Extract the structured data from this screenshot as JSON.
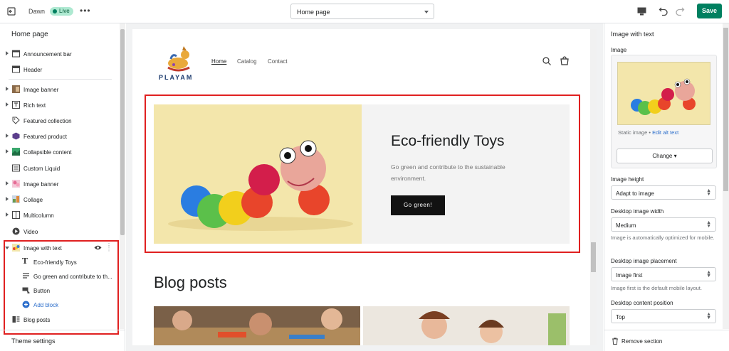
{
  "topbar": {
    "theme_name": "Dawn",
    "live_badge": "Live",
    "more_icon": "ellipsis-icon",
    "page_select": "Home page",
    "save_label": "Save"
  },
  "sidebar": {
    "title": "Home page",
    "items": [
      {
        "label": "Announcement bar",
        "icon": "announcement-icon"
      },
      {
        "label": "Header",
        "icon": "header-icon"
      },
      {
        "label": "Image banner",
        "icon": "image-thumbnail"
      },
      {
        "label": "Rich text",
        "icon": "rich-text-icon"
      },
      {
        "label": "Featured collection",
        "icon": "tag-icon"
      },
      {
        "label": "Featured product",
        "icon": "product-thumbnail"
      },
      {
        "label": "Collapsible content",
        "icon": "collapsible-thumbnail"
      },
      {
        "label": "Custom Liquid",
        "icon": "liquid-icon"
      },
      {
        "label": "Image banner",
        "icon": "image-thumbnail"
      },
      {
        "label": "Collage",
        "icon": "collage-thumbnail"
      },
      {
        "label": "Multicolumn",
        "icon": "columns-icon"
      },
      {
        "label": "Video",
        "icon": "play-icon"
      },
      {
        "label": "Image with text",
        "icon": "image-thumbnail"
      },
      {
        "label": "Eco-friendly Toys",
        "icon": "text-icon"
      },
      {
        "label": "Go green and contribute to th...",
        "icon": "paragraph-icon"
      },
      {
        "label": "Button",
        "icon": "button-icon"
      },
      {
        "label": "Add block",
        "icon": "plus-circle-icon"
      },
      {
        "label": "Blog posts",
        "icon": "blog-icon"
      }
    ],
    "theme_settings": "Theme settings"
  },
  "preview": {
    "logo_text": "PLAYAM",
    "nav": [
      "Home",
      "Catalog",
      "Contact"
    ],
    "hero_title": "Eco-friendly Toys",
    "hero_body": "Go green and contribute to the sustainable environment.",
    "hero_button": "Go green!",
    "blog_heading": "Blog posts"
  },
  "rpanel": {
    "title": "Image with text",
    "image_label": "Image",
    "static_image": "Static image",
    "edit_alt": "Edit alt text",
    "change_label": "Change",
    "image_height_label": "Image height",
    "image_height_value": "Adapt to image",
    "desktop_width_label": "Desktop image width",
    "desktop_width_value": "Medium",
    "desktop_width_help": "Image is automatically optimized for mobile.",
    "placement_label": "Desktop image placement",
    "placement_value": "Image first",
    "placement_help": "Image first is the default mobile layout.",
    "content_position_label": "Desktop content position",
    "content_position_value": "Top",
    "remove_section": "Remove section"
  },
  "colors": {
    "save_green": "#008060",
    "highlight_red": "#e02020",
    "hero_bg": "#f3e6ab",
    "button_dark": "#121212",
    "link_blue": "#2c6ecb"
  }
}
